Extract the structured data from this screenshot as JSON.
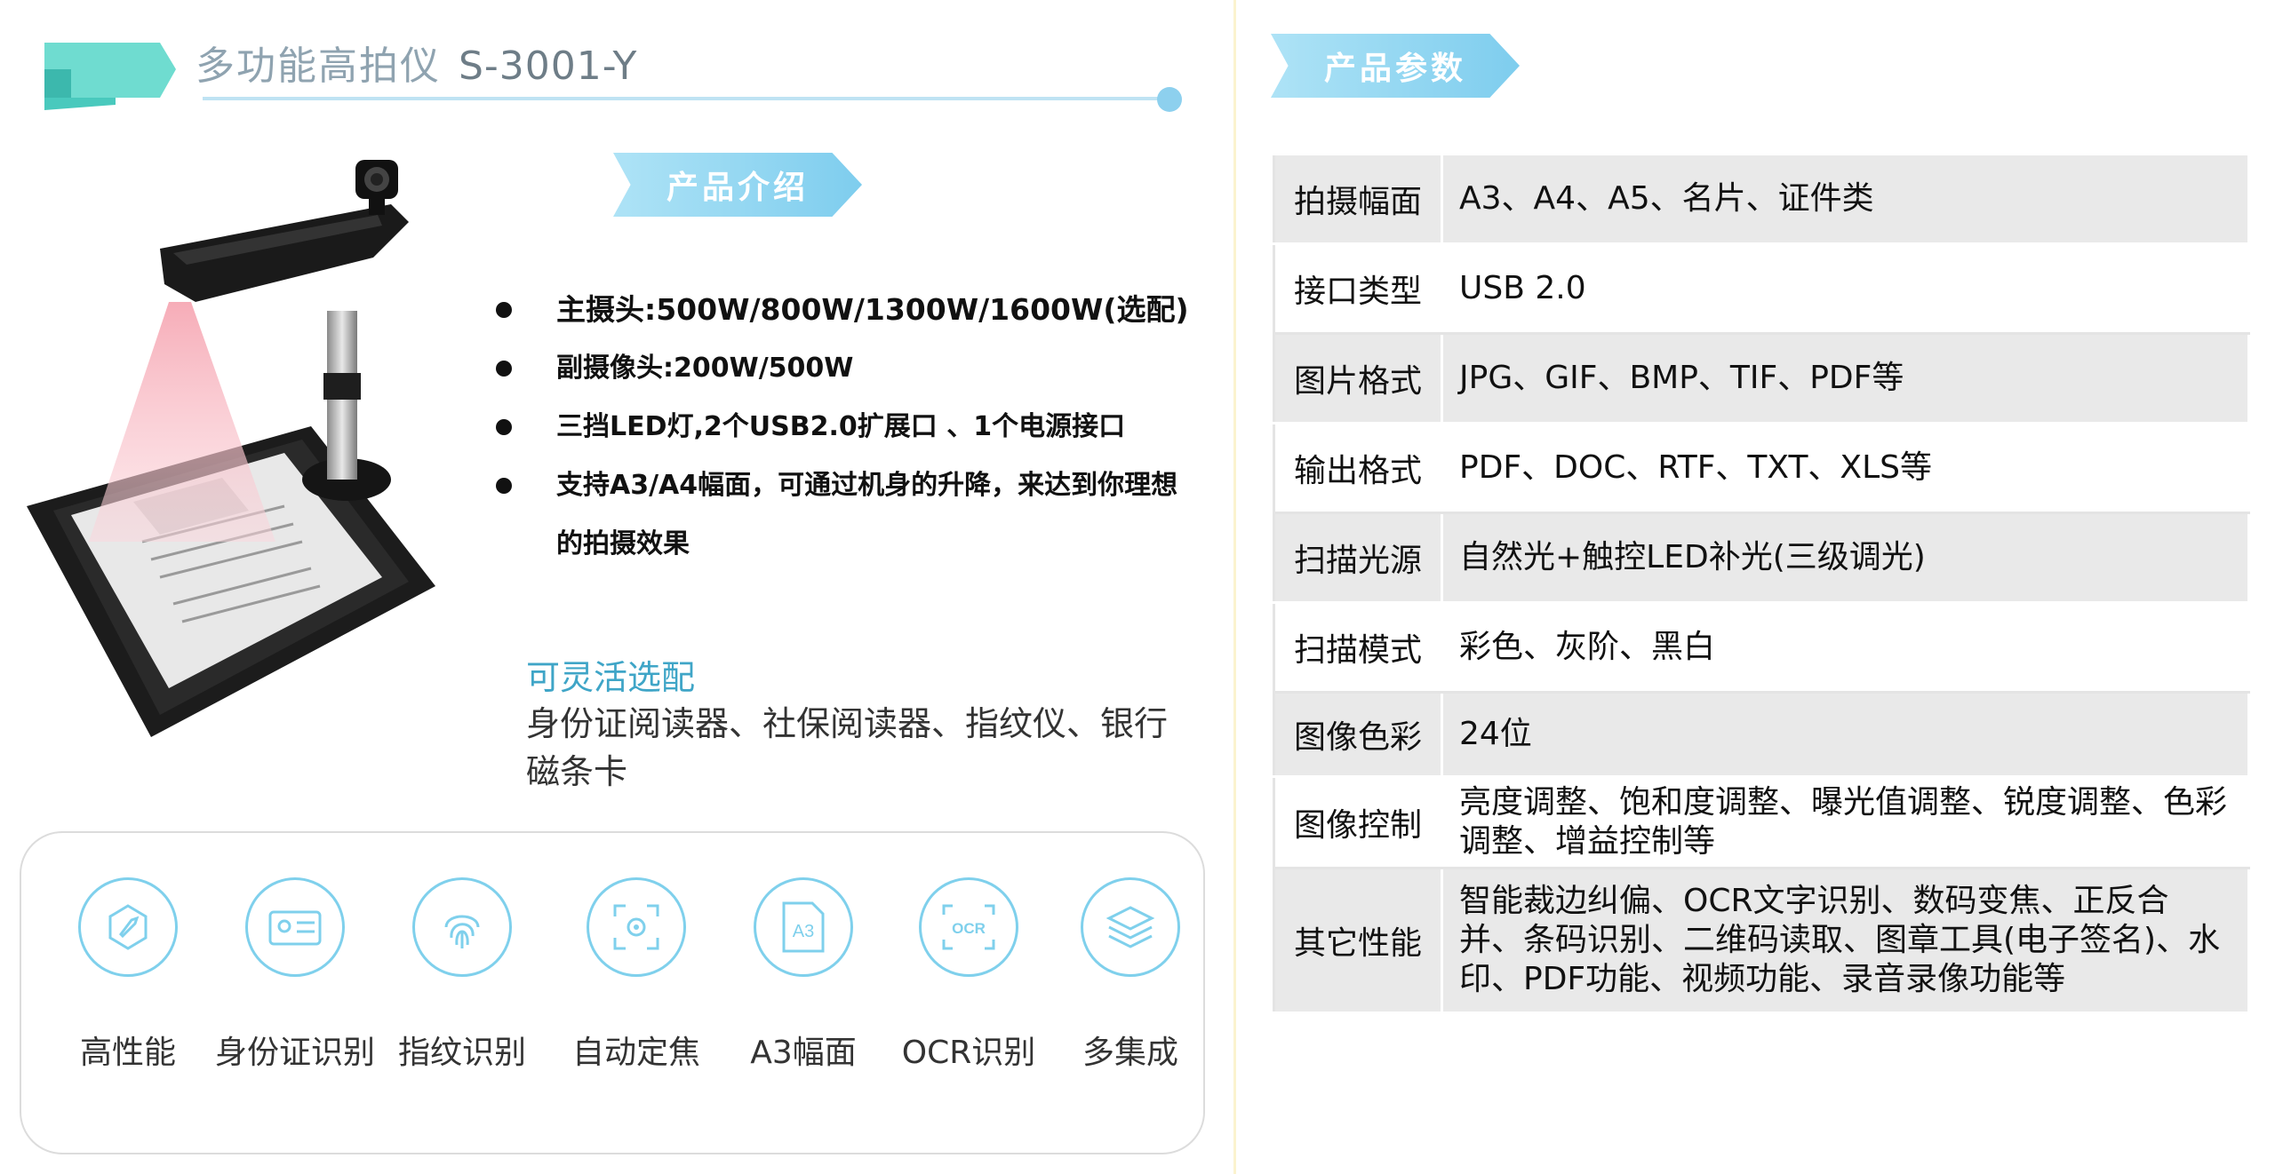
{
  "header": {
    "title": "多功能高拍仪",
    "model": "S-3001-Y"
  },
  "intro": {
    "tag_label": "产品介绍",
    "bullets": [
      "主摄头:500W/800W/1300W/1600W(选配)",
      "副摄像头:200W/500W",
      "三挡LED灯,2个USB2.0扩展口 、1个电源接口",
      "支持A3/A4幅面，可通过机身的升降，来达到你理想的拍摄效果"
    ],
    "optional_title": "可灵活选配",
    "optional_text": "身份证阅读器、社保阅读器、指纹仪、银行磁条卡"
  },
  "features": [
    {
      "label": "高性能",
      "icon": "rocket-icon"
    },
    {
      "label": "身份证识别",
      "icon": "id-card-icon"
    },
    {
      "label": "指纹识别",
      "icon": "fingerprint-icon"
    },
    {
      "label": "自动定焦",
      "icon": "focus-icon"
    },
    {
      "label": "A3幅面",
      "icon": "a3-page-icon",
      "glyph": "A3"
    },
    {
      "label": "OCR识别",
      "icon": "ocr-icon",
      "glyph": "OCR"
    },
    {
      "label": "多集成",
      "icon": "layers-icon"
    }
  ],
  "params": {
    "tag_label": "产品参数",
    "rows": [
      {
        "key": "拍摄幅面",
        "value": "A3、A4、A5、名片、证件类"
      },
      {
        "key": "接口类型",
        "value": "USB 2.0"
      },
      {
        "key": "图片格式",
        "value": "JPG、GIF、BMP、TIF、PDF等"
      },
      {
        "key": "输出格式",
        "value": "PDF、DOC、RTF、TXT、XLS等"
      },
      {
        "key": "扫描光源",
        "value": "自然光+触控LED补光(三级调光)"
      },
      {
        "key": "扫描模式",
        "value": "彩色、灰阶、黑白"
      },
      {
        "key": "图像色彩",
        "value": "24位"
      },
      {
        "key": "图像控制",
        "value": "亮度调整、饱和度调整、曝光值调整、锐度调整、色彩调整、增益控制等"
      },
      {
        "key": "其它性能",
        "value": "智能裁边纠偏、OCR文字识别、数码变焦、正反合并、条码识别、二维码读取、图章工具(电子签名)、水印、PDF功能、视频功能、录音录像功能等"
      }
    ]
  },
  "colors": {
    "accent": "#7ecdee",
    "title_gray": "#8fa3b0",
    "teal_ribbon": "#4fd1c5"
  }
}
